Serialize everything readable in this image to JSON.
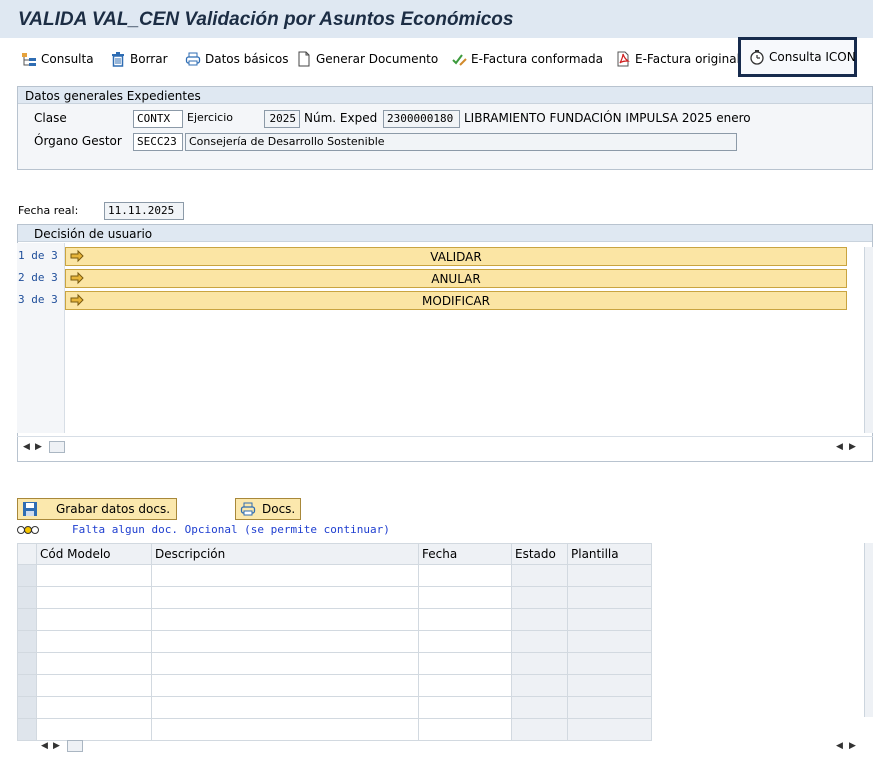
{
  "window": {
    "title": "VALIDA VAL_CEN Validación por Asuntos Económicos"
  },
  "toolbar": {
    "consulta": "Consulta",
    "borrar": "Borrar",
    "datos_basicos": "Datos básicos",
    "generar_documento": "Generar Documento",
    "efactura_conformada": "E-Factura conformada",
    "efactura_original": "E-Factura original",
    "consulta_icon": "Consulta ICON"
  },
  "datos_generales": {
    "header": "Datos generales Expedientes",
    "clase_label": "Clase",
    "clase_value": "CONTX",
    "ejercicio_label": "Ejercicio",
    "ejercicio_value": "2025",
    "num_exped_label": "Núm. Exped",
    "num_exped_value": "2300000180",
    "num_exped_desc": "LIBRAMIENTO FUNDACIÓN IMPULSA 2025 enero",
    "organo_label": "Órgano Gestor",
    "organo_value": "SECC23",
    "organo_desc": "Consejería de Desarrollo Sostenible"
  },
  "fecha": {
    "label": "Fecha real:",
    "value": "11.11.2025"
  },
  "decision": {
    "header": "Decisión de usuario",
    "rows": [
      {
        "num": "1 de 3",
        "label": "VALIDAR"
      },
      {
        "num": "2 de 3",
        "label": "ANULAR"
      },
      {
        "num": "3 de 3",
        "label": "MODIFICAR"
      }
    ]
  },
  "docs": {
    "grabar_label": "Grabar datos docs.",
    "docs_label": "Docs.",
    "status_message": "Falta algun doc. Opcional (se permite continuar)",
    "columns": [
      "Cód Modelo",
      "Descripción",
      "Fecha",
      "Estado",
      "Plantilla"
    ],
    "rows": [
      [
        "",
        "",
        "",
        "",
        ""
      ],
      [
        "",
        "",
        "",
        "",
        ""
      ],
      [
        "",
        "",
        "",
        "",
        ""
      ],
      [
        "",
        "",
        "",
        "",
        ""
      ],
      [
        "",
        "",
        "",
        "",
        ""
      ],
      [
        "",
        "",
        "",
        "",
        ""
      ],
      [
        "",
        "",
        "",
        "",
        ""
      ],
      [
        "",
        "",
        "",
        "",
        ""
      ]
    ]
  },
  "colors": {
    "accent": "#172b4d",
    "title_bg": "#dfe8f2",
    "decision_bg": "#fbe5a4",
    "status_text": "#1f3fd0"
  }
}
